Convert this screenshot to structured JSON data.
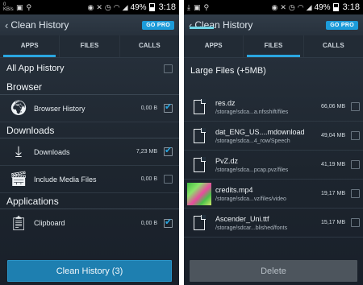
{
  "left": {
    "status": {
      "data": "0 KB/s",
      "battery": "49%",
      "time": "3:18"
    },
    "title": "Clean History",
    "gopro": "GO PRO",
    "tabs": [
      "APPS",
      "FILES",
      "CALLS"
    ],
    "active_tab": 0,
    "all_app_history": "All App History",
    "sections": {
      "browser": "Browser",
      "downloads": "Downloads",
      "applications": "Applications"
    },
    "items": [
      {
        "label": "Browser History",
        "size": "0,00 B",
        "checked": true,
        "icon": "globe-icon"
      },
      {
        "label": "Downloads",
        "size": "7,23 MB",
        "checked": true,
        "icon": "download-icon"
      },
      {
        "label": "Include Media Files",
        "size": "0,00 B",
        "checked": false,
        "icon": "media-files-icon"
      },
      {
        "label": "Clipboard",
        "size": "0,00 B",
        "checked": true,
        "icon": "clipboard-icon"
      }
    ],
    "clean_button": "Clean History (3)"
  },
  "right": {
    "status": {
      "battery": "49%",
      "time": "3:18"
    },
    "title": "Clean History",
    "gopro": "GO PRO",
    "tabs": [
      "APPS",
      "FILES",
      "CALLS"
    ],
    "active_tab": 1,
    "large_files": "Large Files (+5MB)",
    "files": [
      {
        "name": "res.dz",
        "path": "/storage/sdca...a.nfsshift/files",
        "size": "66,06 MB"
      },
      {
        "name": "dat_ENG_US....mdownload",
        "path": "/storage/sdca...4_row/Speech",
        "size": "49,04 MB"
      },
      {
        "name": "PvZ.dz",
        "path": "/storage/sdca...pcap.pvz/files",
        "size": "41,19 MB"
      },
      {
        "name": "credits.mp4",
        "path": "/storage/sdca...vz/files/video",
        "size": "19,17 MB"
      },
      {
        "name": "Ascender_Uni.ttf",
        "path": "/storage/sdcar...blished/fonts",
        "size": "15,17 MB"
      }
    ],
    "delete_button": "Delete"
  }
}
